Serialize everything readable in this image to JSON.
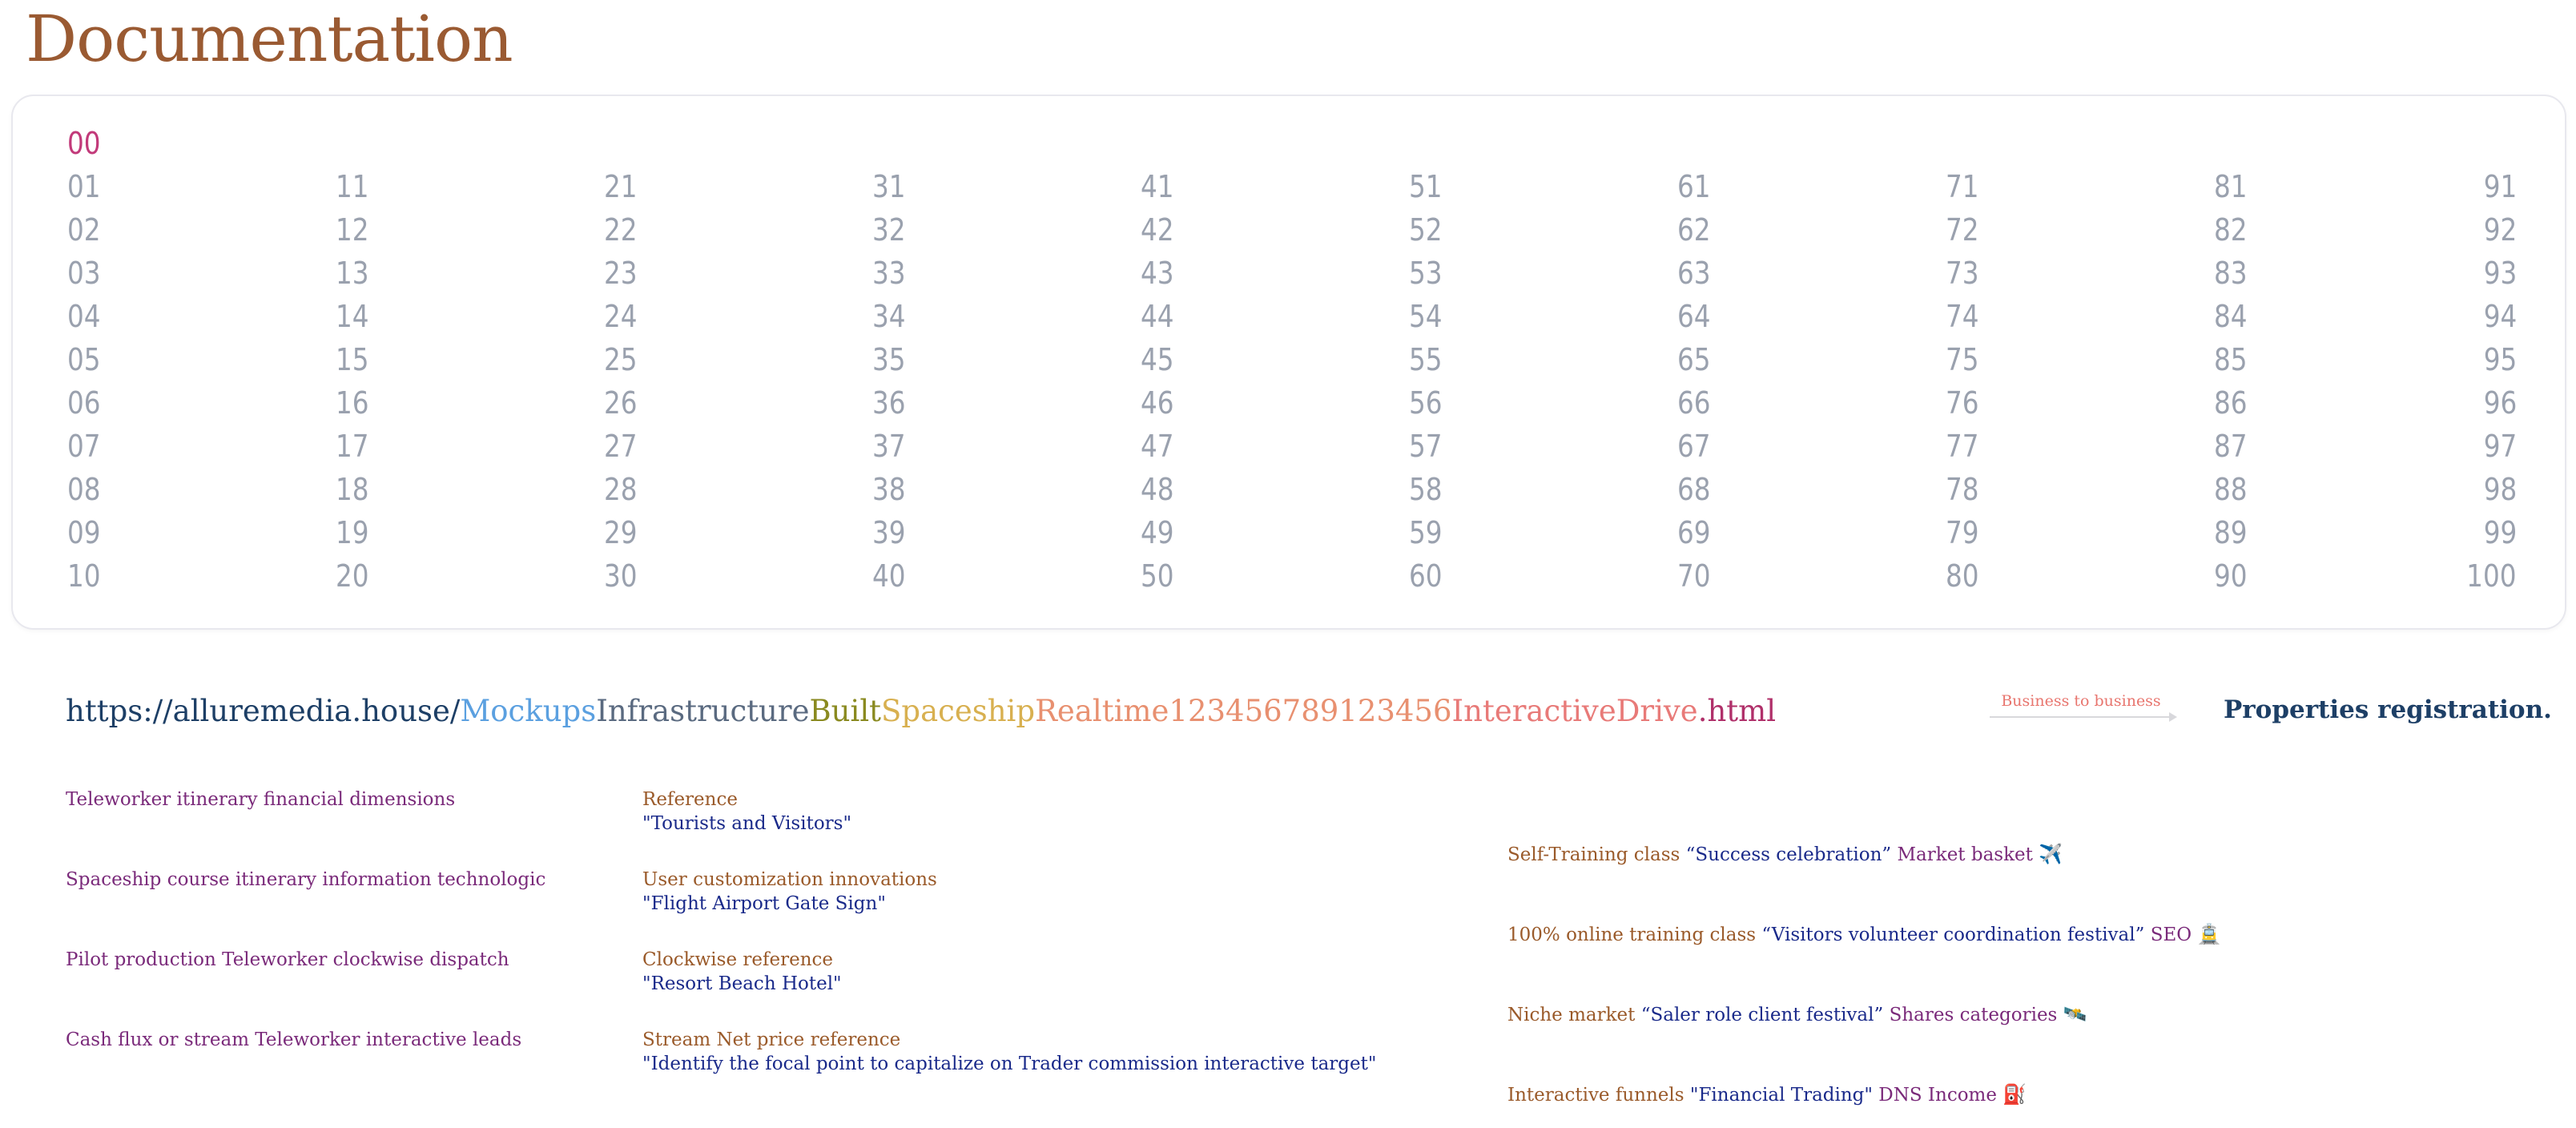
{
  "title": "Documentation",
  "numbers": {
    "zero": "00",
    "columns": [
      [
        "01",
        "02",
        "03",
        "04",
        "05",
        "06",
        "07",
        "08",
        "09",
        "10"
      ],
      [
        "11",
        "12",
        "13",
        "14",
        "15",
        "16",
        "17",
        "18",
        "19",
        "20"
      ],
      [
        "21",
        "22",
        "23",
        "24",
        "25",
        "26",
        "27",
        "28",
        "29",
        "30"
      ],
      [
        "31",
        "32",
        "33",
        "34",
        "35",
        "36",
        "37",
        "38",
        "39",
        "40"
      ],
      [
        "41",
        "42",
        "43",
        "44",
        "45",
        "46",
        "47",
        "48",
        "49",
        "50"
      ],
      [
        "51",
        "52",
        "53",
        "54",
        "55",
        "56",
        "57",
        "58",
        "59",
        "60"
      ],
      [
        "61",
        "62",
        "63",
        "64",
        "65",
        "66",
        "67",
        "68",
        "69",
        "70"
      ],
      [
        "71",
        "72",
        "73",
        "74",
        "75",
        "76",
        "77",
        "78",
        "79",
        "80"
      ],
      [
        "81",
        "82",
        "83",
        "84",
        "85",
        "86",
        "87",
        "88",
        "89",
        "90"
      ],
      [
        "91",
        "92",
        "93",
        "94",
        "95",
        "96",
        "97",
        "98",
        "99",
        "100"
      ]
    ]
  },
  "url": {
    "segments": [
      {
        "text": "https://alluremedia.house/",
        "color": "#1d3f66"
      },
      {
        "text": "Mockups",
        "color": "#5ba0e0"
      },
      {
        "text": "Infrastructure",
        "color": "#5a6a80"
      },
      {
        "text": "Built",
        "color": "#8a8a20"
      },
      {
        "text": "Spaceship",
        "color": "#d8b050"
      },
      {
        "text": "Realtime123456789123456",
        "color": "#e89070"
      },
      {
        "text": "InteractiveDrive",
        "color": "#e87a78"
      },
      {
        "text": ".html",
        "color": "#b0306a"
      }
    ]
  },
  "b2b_label": "Business to business",
  "properties_registration": "Properties registration.",
  "left_items": [
    "Teleworker itinerary financial dimensions",
    "Spaceship course itinerary information technologic",
    "Pilot production Teleworker clockwise dispatch",
    "Cash flux or stream Teleworker interactive leads"
  ],
  "mid_items": [
    {
      "label": "Reference",
      "value": "\"Tourists and Visitors\""
    },
    {
      "label": "User customization innovations",
      "value": "\"Flight Airport Gate Sign\""
    },
    {
      "label": "Clockwise reference",
      "value": "\"Resort Beach Hotel\""
    },
    {
      "label": "Stream Net price reference",
      "value": "\"Identify the focal point to capitalize on Trader commission interactive target\""
    }
  ],
  "right_items": [
    {
      "a": "Self-Training class ",
      "q": "“Success celebration”",
      "c": " Market basket ",
      "icon": "✈️",
      "icon_name": "airplane-icon"
    },
    {
      "a": "100% online training class ",
      "q": "“Visitors volunteer coordination festival”",
      "c": " SEO ",
      "icon": "🚊",
      "icon_name": "tram-icon"
    },
    {
      "a": "Niche market ",
      "q": "“Saler role client festival”",
      "c": " Shares categories ",
      "icon": "🛰️",
      "icon_name": "satellite-icon"
    },
    {
      "a": "Interactive funnels ",
      "q": "\"Financial Trading\"",
      "c": " DNS Income ",
      "icon": "⛽",
      "icon_name": "fuel-pump-icon"
    }
  ]
}
